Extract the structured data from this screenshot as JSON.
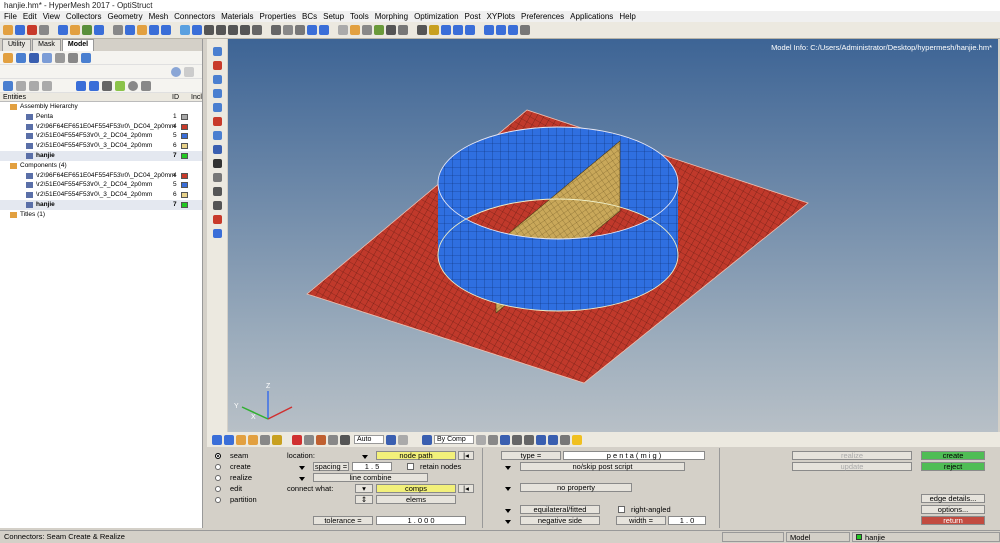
{
  "title": "hanjie.hm* - HyperMesh 2017 - OptiStruct",
  "menu": [
    "File",
    "Edit",
    "View",
    "Collectors",
    "Geometry",
    "Mesh",
    "Connectors",
    "Materials",
    "Properties",
    "BCs",
    "Setup",
    "Tools",
    "Morphing",
    "Optimization",
    "Post",
    "XYPlots",
    "Preferences",
    "Applications",
    "Help"
  ],
  "tabs": [
    "Utility",
    "Mask",
    "Model"
  ],
  "entities": {
    "header_entities": "Entities",
    "header_id": "ID",
    "header_incl": "Incl",
    "rows": [
      {
        "label": "Assembly Hierarchy",
        "id": "",
        "color": "",
        "level": 0
      },
      {
        "label": "Penta",
        "id": "1",
        "color": "#a8a8a8",
        "level": 1
      },
      {
        "label": "\\r2\\96F64EF651E04F554F53\\r0\\_DC04_2p0mm",
        "id": "4",
        "color": "#c83a2a",
        "level": 1
      },
      {
        "label": "\\r2\\51E04F554F53\\r0\\_2_DC04_2p0mm",
        "id": "5",
        "color": "#3a6ed8",
        "level": 1
      },
      {
        "label": "\\r2\\51E04F554F53\\r0\\_3_DC04_2p0mm",
        "id": "6",
        "color": "#e8d28a",
        "level": 1
      },
      {
        "label": "hanjie",
        "id": "7",
        "color": "#22c822",
        "level": 1,
        "selected": true
      },
      {
        "label": "Components (4)",
        "id": "",
        "color": "",
        "level": 0
      },
      {
        "label": "\\r2\\96F64EF651E04F554F53\\r0\\_DC04_2p0mm",
        "id": "4",
        "color": "#c83a2a",
        "level": 1
      },
      {
        "label": "\\r2\\51E04F554F53\\r0\\_2_DC04_2p0mm",
        "id": "5",
        "color": "#3a6ed8",
        "level": 1
      },
      {
        "label": "\\r2\\51E04F554F53\\r0\\_3_DC04_2p0mm",
        "id": "6",
        "color": "#e8d28a",
        "level": 1
      },
      {
        "label": "hanjie",
        "id": "7",
        "color": "#22c822",
        "level": 1,
        "selected": true
      },
      {
        "label": "Titles (1)",
        "id": "",
        "color": "",
        "level": 0
      }
    ]
  },
  "viewport": {
    "model_info": "Model Info: C:/Users/Administrator/Desktop/hypermesh/hanjie.hm*"
  },
  "bottom_toolbar": {
    "auto": "Auto",
    "by_comp": "By Comp"
  },
  "panel": {
    "modes": [
      "seam",
      "create",
      "realize",
      "edit",
      "partition"
    ],
    "selected_mode": "seam",
    "location_label": "location:",
    "node_path": "node path",
    "spacing_label": "spacing =",
    "spacing_value": "1 . 5",
    "retain_nodes": "retain nodes",
    "line_combine": "line combine",
    "connect_what_label": "connect what:",
    "comps": "comps",
    "elems": "elems",
    "tolerance_label": "tolerance =",
    "tolerance_value": "1 . 0 0 0",
    "type_label": "type =",
    "type_value": "p e n t a   ( m i g )",
    "no_skip_post_script": "no/skip post script",
    "no_property": "no property",
    "equilateral_fitted": "equilateral/fitted",
    "negative_side": "negative side",
    "right_angled": "right-angled",
    "width_label": "width =",
    "width_value": "1 . 0",
    "create": "create",
    "reject": "reject",
    "edge_details": "edge details...",
    "options": "options...",
    "return": "return",
    "greyed": [
      "realize",
      "update"
    ]
  },
  "status": {
    "message": "Connectors: Seam Create & Realize",
    "model": "Model",
    "component": "hanjie"
  }
}
